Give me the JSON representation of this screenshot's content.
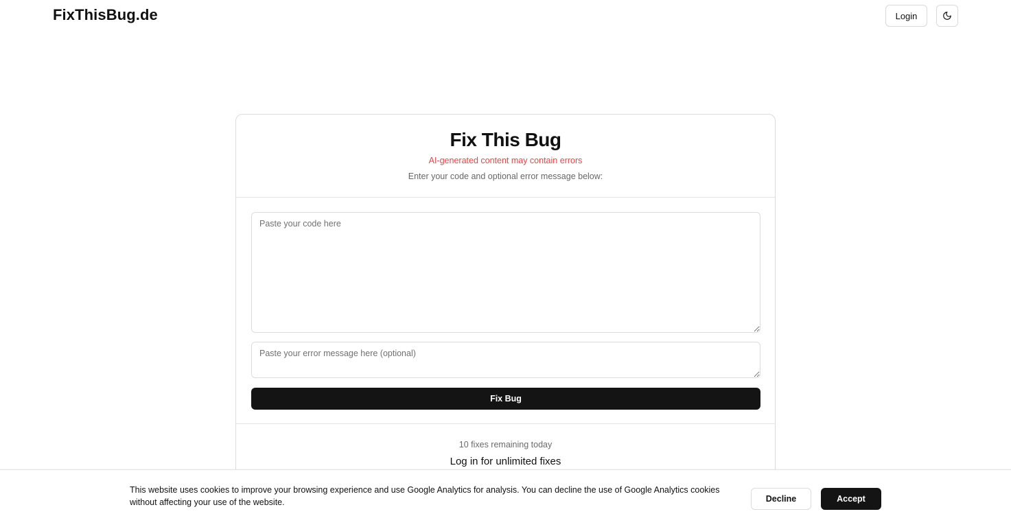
{
  "header": {
    "brand": "FixThisBug.de",
    "login_label": "Login",
    "theme_toggle_icon": "moon-icon"
  },
  "card": {
    "title": "Fix This Bug",
    "warning": "AI-generated content may contain errors",
    "subtitle": "Enter your code and optional error message below:",
    "code_input": {
      "value": "",
      "placeholder": "Paste your code here"
    },
    "error_input": {
      "value": "",
      "placeholder": "Paste your error message here (optional)"
    },
    "submit_label": "Fix Bug",
    "remaining_text": "10 fixes remaining today",
    "login_prompt": "Log in for unlimited fixes"
  },
  "cookie_banner": {
    "text": "This website uses cookies to improve your browsing experience and use Google Analytics for analysis. You can decline the use of Google Analytics cookies without affecting your use of the website.",
    "decline_label": "Decline",
    "accept_label": "Accept"
  },
  "colors": {
    "warning": "#e0474c",
    "primary_button": "#141414",
    "border": "#dcdcdc"
  }
}
